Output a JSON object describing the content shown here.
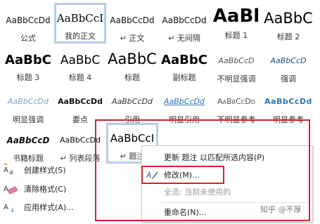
{
  "gallery": {
    "rows": [
      [
        {
          "name": "公式",
          "sample": "AaBbCcDd",
          "style": "s-normal"
        },
        {
          "name": "我的正文",
          "sample": "AaBbCcI",
          "style": "s-mine",
          "selected": true
        },
        {
          "name": "↵ 正文",
          "sample": "AaBbCcDd",
          "style": "s-normal"
        },
        {
          "name": "↵ 无间隔",
          "sample": "AaBbCcDd",
          "style": "s-normal"
        },
        {
          "name": "标题 1",
          "sample": "AaBl",
          "style": "s-title"
        },
        {
          "name": "标题 2",
          "sample": "AaBbC",
          "style": "s-h1"
        }
      ],
      [
        {
          "name": "标题 3",
          "sample": "AaBbC",
          "style": "s-h3"
        },
        {
          "name": "标题 4",
          "sample": "AaBbC",
          "style": "s-h4"
        },
        {
          "name": "标题",
          "sample": "AaBbC",
          "style": "s-h1"
        },
        {
          "name": "副标题",
          "sample": "AaBbC",
          "style": "s-sub"
        },
        {
          "name": "不明显强调",
          "sample": "AaBbCcD",
          "style": "s-light"
        },
        {
          "name": "强调",
          "sample": "AaBbCcD",
          "style": "s-emph"
        }
      ],
      [
        {
          "name": "明显强调",
          "sample": "AaBbCcDd",
          "style": "s-faint"
        },
        {
          "name": "要点",
          "sample": "AaBbCcDd",
          "style": "s-strong"
        },
        {
          "name": "引用",
          "sample": "AaBbCcDd",
          "style": "s-quote"
        },
        {
          "name": "明显引用",
          "sample": "AaBbCcDd",
          "style": "s-iquote"
        },
        {
          "name": "不明显参考",
          "sample": "AaBbCcDd",
          "style": "s-sref"
        },
        {
          "name": "明显参考",
          "sample": "AaBbCcDd",
          "style": "s-iref"
        }
      ],
      [
        {
          "name": "书籍标题",
          "sample": "AaBbCcD",
          "style": "s-book"
        },
        {
          "name": "↵ 列表段落",
          "sample": "AaBbCcDd",
          "style": "s-list"
        },
        {
          "name": "↵ 题注",
          "sample": "AaBbCcI",
          "style": "s-caption",
          "focused": true
        }
      ]
    ]
  },
  "commands": [
    {
      "label": "创建样式(S)",
      "icon": "create-style-icon"
    },
    {
      "label": "清除格式(C)",
      "icon": "clear-format-icon"
    },
    {
      "label": "应用样式(A)...",
      "icon": "apply-style-icon"
    }
  ],
  "context_menu": {
    "update": "更新 题注 以匹配所选内容(P)",
    "modify": "修改(M)...",
    "select_all": "全选: 当前未使用的",
    "rename": "重命名(N)..."
  },
  "watermark": "知乎 @不厚",
  "colors": {
    "highlight": "#d0242e",
    "selection": "#b8cce4"
  }
}
